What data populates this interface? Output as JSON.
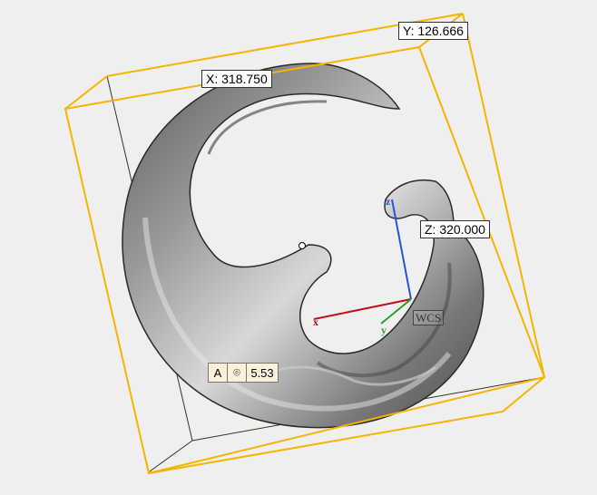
{
  "dimensions": {
    "x_label": "X: 318.750",
    "y_label": "Y: 126.666",
    "z_label": "Z: 320.000"
  },
  "coordinate_system": {
    "wcs_label": "WCS",
    "axis_x": "x",
    "axis_y": "y",
    "axis_z": "z",
    "colors": {
      "x": "#c0101a",
      "y": "#2aa02a",
      "z": "#2255dd"
    }
  },
  "feature_control_frame": {
    "datum": "A",
    "symbol": "⌾",
    "tolerance": "5.53"
  },
  "bounding_box_color": "#f5b400"
}
